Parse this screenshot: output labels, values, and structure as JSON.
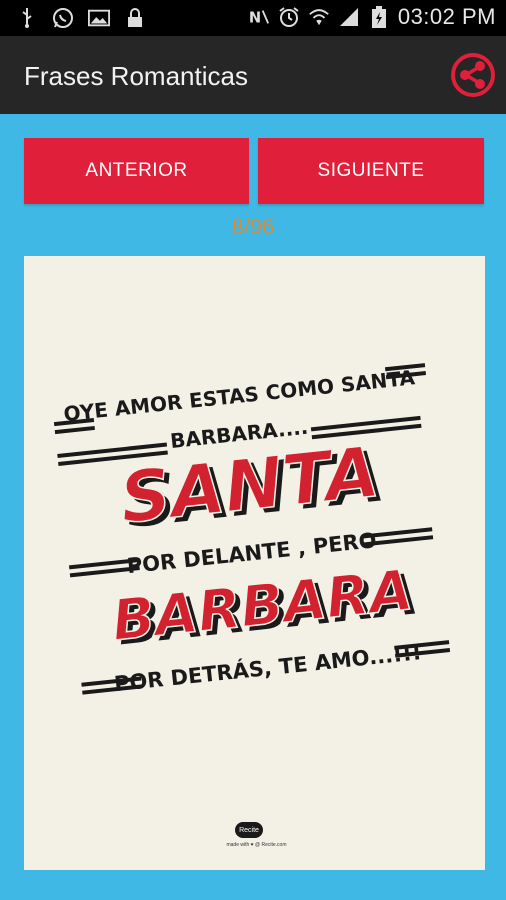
{
  "status_bar": {
    "time": "03:02 PM",
    "left_icons": [
      "usb-icon",
      "whatsapp-icon",
      "image-icon",
      "lock-icon"
    ],
    "right_icons": [
      "nfc-icon",
      "alarm-icon",
      "wifi-icon",
      "signal-icon",
      "battery-icon"
    ]
  },
  "app_bar": {
    "title": "Frases Romanticas",
    "share_icon": "share-icon"
  },
  "nav": {
    "prev_label": "ANTERIOR",
    "next_label": "SIGUIENTE"
  },
  "counter": "8/96",
  "poster": {
    "line1": "OYE AMOR ESTAS COMO SANTA",
    "line2": "BARBARA....",
    "big1": "SANTA",
    "line3": "POR DELANTE , PERO",
    "big2": "BARBARA",
    "line4": "POR DETRÁS, TE AMO...!!!",
    "badge": "Recite",
    "madewith": "made with ♥ @ Recite.com"
  },
  "colors": {
    "background": "#3fb8e6",
    "appbar": "#262626",
    "button": "#e0203a",
    "counter": "#d88b3a",
    "poster_bg": "#f3f1e6",
    "poster_red": "#d3222f"
  }
}
